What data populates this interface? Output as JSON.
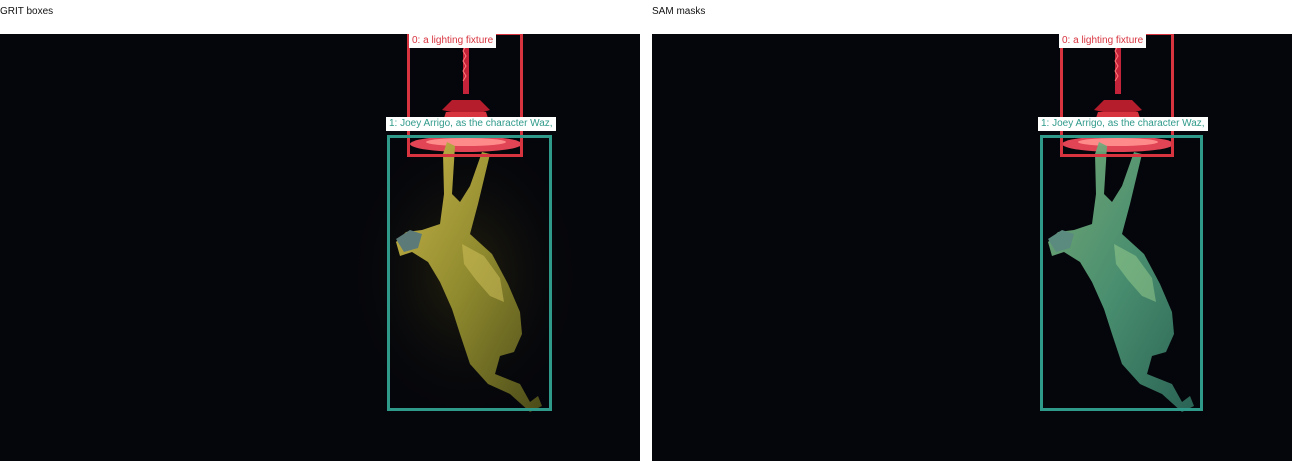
{
  "panels": [
    {
      "title": "GRIT boxes",
      "detections": [
        {
          "label": "0: a lighting fixture",
          "color": "#d8343f"
        },
        {
          "label": "1: Joey Arrigo, as the character Waz,",
          "color": "#2f9a8a"
        }
      ]
    },
    {
      "title": "SAM masks",
      "detections": [
        {
          "label": "0: a lighting fixture",
          "color": "#d8343f"
        },
        {
          "label": "1: Joey Arrigo, as the character Waz,",
          "color": "#2f9a8a"
        }
      ]
    }
  ],
  "colors": {
    "background": "#05060b",
    "fixture": "#d8343f",
    "person": "#2f9a8a",
    "mask_tint": "#4f9a78"
  }
}
